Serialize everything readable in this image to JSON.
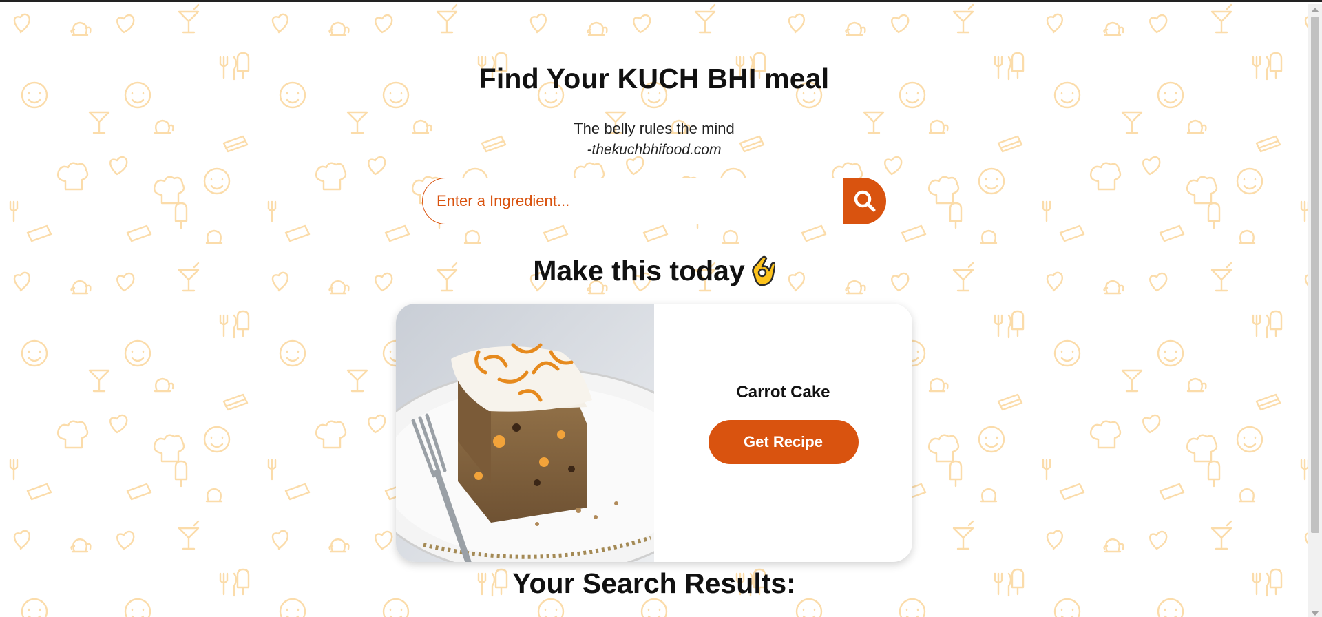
{
  "header": {
    "title": "Find Your KUCH BHI meal",
    "quote": "The belly rules the mind",
    "quote_source": "-thekuchbhifood.com"
  },
  "search": {
    "placeholder": "Enter a Ingredient...",
    "value": ""
  },
  "featured": {
    "section_title": "Make this today",
    "section_emoji": "ok-hand-emoji",
    "recipe_name": "Carrot Cake",
    "button_label": "Get Recipe",
    "image_alt": "carrot-cake-photo"
  },
  "results": {
    "title": "Your Search Results:"
  },
  "colors": {
    "accent": "#d9530f",
    "pattern": "#fbdcaa",
    "text": "#111111"
  }
}
